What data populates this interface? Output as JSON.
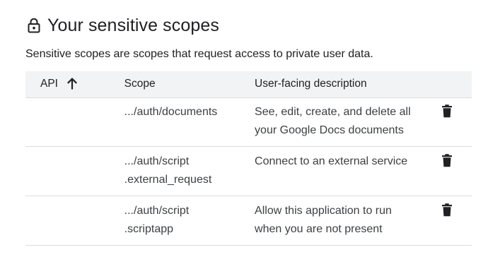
{
  "section": {
    "title": "Your sensitive scopes",
    "description": "Sensitive scopes are scopes that request access to private user data.",
    "icon": "lock-icon"
  },
  "table": {
    "headers": {
      "api": "API",
      "scope": "Scope",
      "description": "User-facing description"
    },
    "sort": {
      "column": "api",
      "direction": "ascending",
      "icon": "arrow-up-icon"
    },
    "rows": [
      {
        "api": "",
        "scope_line1": ".../auth/documents",
        "scope_line2": "",
        "desc_line1": "See, edit, create, and delete all",
        "desc_line2": "your Google Docs documents",
        "action_icon": "trash-icon"
      },
      {
        "api": "",
        "scope_line1": ".../auth/script",
        "scope_line2": ".external_request",
        "desc_line1": "Connect to an external service",
        "desc_line2": "",
        "action_icon": "trash-icon"
      },
      {
        "api": "",
        "scope_line1": ".../auth/script",
        "scope_line2": ".scriptapp",
        "desc_line1": "Allow this application to run",
        "desc_line2": "when you are not present",
        "action_icon": "trash-icon"
      }
    ]
  },
  "colors": {
    "header_bg": "#f1f3f4",
    "divider": "#dadce0",
    "text_primary": "#202124",
    "text_secondary": "#3c4043"
  }
}
